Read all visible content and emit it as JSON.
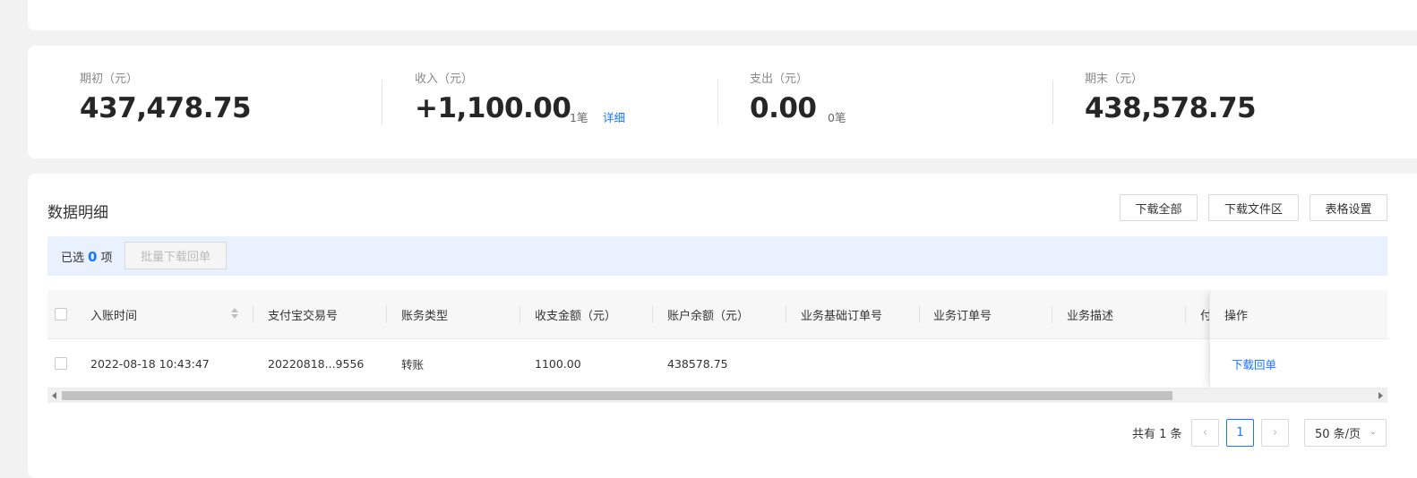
{
  "summary": {
    "opening": {
      "label": "期初（元）",
      "value": "437,478.75"
    },
    "income": {
      "label": "收入（元）",
      "value": "+1,100.00",
      "count": "1笔",
      "detail_link": "详细"
    },
    "expense": {
      "label": "支出（元）",
      "value": "0.00",
      "count": "0笔"
    },
    "closing": {
      "label": "期末（元）",
      "value": "438,578.75"
    }
  },
  "detail": {
    "title": "数据明细",
    "buttons": {
      "download_all": "下载全部",
      "download_area": "下载文件区",
      "table_settings": "表格设置"
    },
    "selection": {
      "prefix": "已选",
      "count": "0",
      "suffix": "项",
      "batch_button": "批量下载回单"
    },
    "columns": [
      "入账时间",
      "支付宝交易号",
      "账务类型",
      "收支金额（元）",
      "账户余额（元）",
      "业务基础订单号",
      "业务订单号",
      "业务描述",
      "付",
      "操作"
    ],
    "rows": [
      {
        "time": "2022-08-18 10:43:47",
        "trade_no": "20220818...9556",
        "type": "转账",
        "amount": "1100.00",
        "balance": "438578.75",
        "action": "下载回单"
      }
    ]
  },
  "pagination": {
    "total": "共有 1 条",
    "current_page": "1",
    "page_size": "50 条/页",
    "prev_icon": "‹",
    "next_icon": "›"
  }
}
